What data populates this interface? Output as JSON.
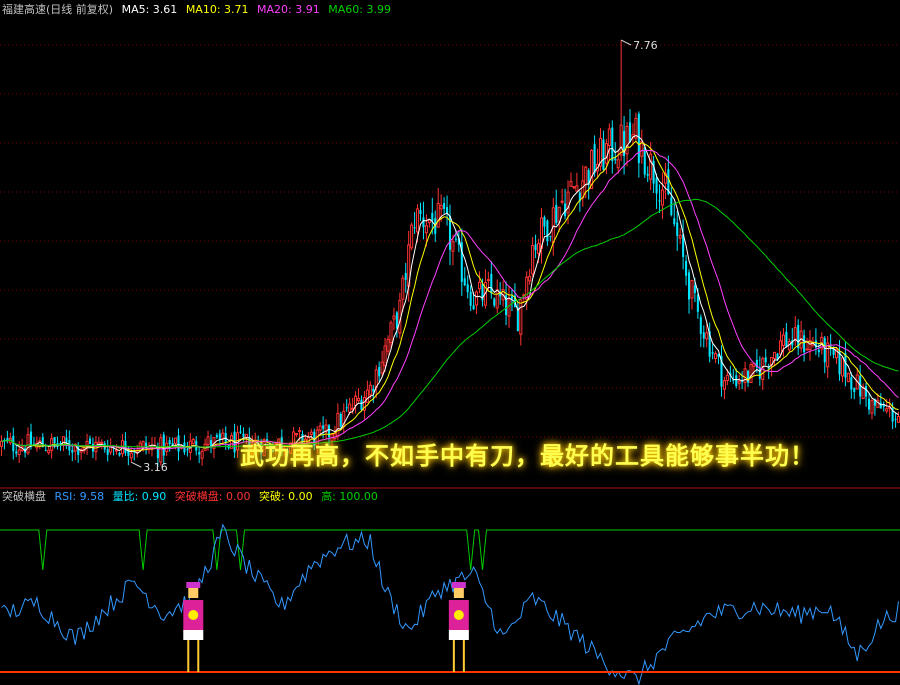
{
  "main_header": {
    "title": "福建高速(日线 前复权)",
    "ma5": "MA5: 3.61",
    "ma10": "MA10: 3.71",
    "ma20": "MA20: 3.91",
    "ma60": "MA60: 3.99"
  },
  "indicator_header": {
    "title": "突破横盘",
    "rsi": "RSI: 9.58",
    "volratio": "量比: 0.90",
    "breakout_range": "突破横盘: 0.00",
    "breakout": "突破: 0.00",
    "high": "高: 100.00"
  },
  "slogan": "武功再高，不如手中有刀，最好的工具能够事半功！",
  "colors": {
    "up": "#ff3232",
    "down": "#00e5ff",
    "ma5": "#ffffff",
    "ma10": "#ffff00",
    "ma20": "#ff40ff",
    "ma60": "#00d000",
    "rsi": "#3399ff",
    "threshold": "#00cc00",
    "baseline": "#ff3300"
  },
  "chart_data": [
    {
      "type": "candlestick",
      "title": "福建高速(日线 前复权)",
      "y_range": [
        2.9,
        8.0
      ],
      "annotations": [
        {
          "label": "7.76",
          "value": 7.76
        },
        {
          "label": "3.16",
          "value": 3.16
        }
      ],
      "series_names": [
        "MA5",
        "MA10",
        "MA20",
        "MA60"
      ],
      "anchors": [
        [
          0,
          3.35
        ],
        [
          20,
          3.34
        ],
        [
          40,
          3.33
        ],
        [
          55,
          3.31
        ],
        [
          70,
          3.36
        ],
        [
          95,
          3.37
        ],
        [
          110,
          3.45
        ],
        [
          125,
          3.97
        ],
        [
          135,
          4.82
        ],
        [
          140,
          5.84
        ],
        [
          150,
          5.76
        ],
        [
          160,
          4.93
        ],
        [
          165,
          5.01
        ],
        [
          175,
          4.76
        ],
        [
          180,
          5.52
        ],
        [
          190,
          6.0
        ],
        [
          205,
          6.55
        ],
        [
          215,
          6.7
        ],
        [
          225,
          6.1
        ],
        [
          235,
          4.85
        ],
        [
          245,
          4.05
        ],
        [
          255,
          4.11
        ],
        [
          265,
          4.49
        ],
        [
          275,
          4.45
        ],
        [
          285,
          4.2
        ],
        [
          295,
          3.78
        ],
        [
          304,
          3.66
        ]
      ],
      "ma_periods": [
        5,
        10,
        20,
        60
      ]
    },
    {
      "type": "line",
      "title": "突破横盘",
      "y_range": [
        0,
        100
      ],
      "rsi_anchors": [
        [
          0,
          35
        ],
        [
          12,
          42
        ],
        [
          25,
          20
        ],
        [
          35,
          38
        ],
        [
          45,
          55
        ],
        [
          55,
          35
        ],
        [
          65,
          45
        ],
        [
          75,
          85
        ],
        [
          85,
          60
        ],
        [
          95,
          40
        ],
        [
          105,
          65
        ],
        [
          115,
          78
        ],
        [
          125,
          80
        ],
        [
          130,
          50
        ],
        [
          138,
          25
        ],
        [
          148,
          50
        ],
        [
          160,
          60
        ],
        [
          170,
          20
        ],
        [
          180,
          45
        ],
        [
          190,
          30
        ],
        [
          205,
          5
        ],
        [
          215,
          -5
        ],
        [
          225,
          15
        ],
        [
          240,
          35
        ],
        [
          255,
          40
        ],
        [
          270,
          35
        ],
        [
          280,
          40
        ],
        [
          290,
          10
        ],
        [
          298,
          30
        ],
        [
          304,
          38
        ]
      ],
      "threshold_value": 100,
      "dip_positions": [
        14,
        48,
        73,
        81,
        159,
        163
      ],
      "figure_positions": [
        65,
        155
      ]
    }
  ]
}
